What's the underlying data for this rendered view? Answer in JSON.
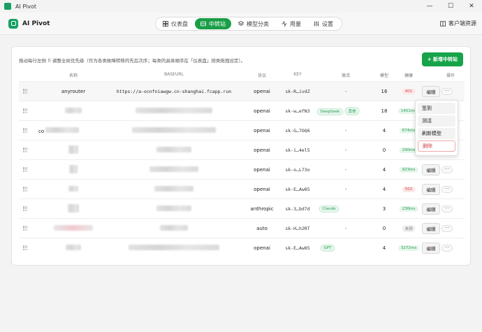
{
  "window": {
    "title": "AI Pivot",
    "minimize": "—",
    "maximize": "☐",
    "close": "✕"
  },
  "brand": {
    "name": "AI Pivot"
  },
  "nav": [
    {
      "label": "仪表盘",
      "icon": "dashboard-icon",
      "active": false
    },
    {
      "label": "中转站",
      "icon": "relay-icon",
      "active": true
    },
    {
      "label": "模型分类",
      "icon": "layers-icon",
      "active": false
    },
    {
      "label": "用量",
      "icon": "activity-icon",
      "active": false
    },
    {
      "label": "设置",
      "icon": "sliders-icon",
      "active": false
    }
  ],
  "client_resources": "客户端资源",
  "hint": "拖动每行左侧 ⠿ 调整全局优先级（作为各类故障转移的先后次序；每类的具体顺序在「仪表盘」按类拖拽设定）。",
  "add_button": "+ 新增中转站",
  "columns": {
    "name": "名称",
    "baseurl": "BASEURL",
    "protocol": "协议",
    "key": "KEY",
    "activate": "激活",
    "models": "模型",
    "health": "健康",
    "actions": "操作"
  },
  "rows": [
    {
      "name": "anyrouter",
      "url": "https://a-ocnfniawgw.cn-shanghai.fcapp.run",
      "protocol": "openai",
      "key": "sk-R…ivdZ",
      "tags": [],
      "activate": "-",
      "models": "16",
      "health": "401",
      "health_status": "bad"
    },
    {
      "name": "",
      "url": "",
      "protocol": "openai",
      "key": "sk-w…efN3",
      "tags": [
        "DeepSeek",
        "其他"
      ],
      "activate": "",
      "models": "18",
      "health": "1451ms",
      "health_status": "ok"
    },
    {
      "name": "co",
      "url": "",
      "protocol": "openai",
      "key": "sk-G…7OQ6",
      "tags": [],
      "activate": "-",
      "models": "4",
      "health": "674ms",
      "health_status": "ok"
    },
    {
      "name": "",
      "url": "",
      "protocol": "openai",
      "key": "sk-i…4el5",
      "tags": [],
      "activate": "-",
      "models": "0",
      "health": "290ms",
      "health_status": "ok"
    },
    {
      "name": "",
      "url": "",
      "protocol": "openai",
      "key": "sk-o…L73o",
      "tags": [],
      "activate": "-",
      "models": "4",
      "health": "923ms",
      "health_status": "ok"
    },
    {
      "name": "",
      "url": "",
      "protocol": "openai",
      "key": "sk-E…Aw85",
      "tags": [],
      "activate": "-",
      "models": "4",
      "health": "502",
      "health_status": "bad"
    },
    {
      "name": "",
      "url": "",
      "protocol": "anthropic",
      "key": "sk-3…bd7d",
      "tags": [
        "Claude"
      ],
      "activate": "",
      "models": "3",
      "health": "236ms",
      "health_status": "ok"
    },
    {
      "name": "",
      "url": "",
      "protocol": "auto",
      "key": "sk-H…h2RT",
      "tags": [],
      "activate": "-",
      "models": "0",
      "health": "未测",
      "health_status": "none"
    },
    {
      "name": "",
      "url": "",
      "protocol": "openai",
      "key": "sk-E…Aw85",
      "tags": [
        "GPT"
      ],
      "activate": "",
      "models": "4",
      "health": "3272ms",
      "health_status": "ok"
    }
  ],
  "edit_label": "编辑",
  "more_label": "···",
  "menu": {
    "checkin": "签到",
    "test": "测活",
    "refresh_models": "刷新模型",
    "delete": "删除"
  },
  "colors": {
    "accent": "#17a34a",
    "danger": "#d24444"
  }
}
